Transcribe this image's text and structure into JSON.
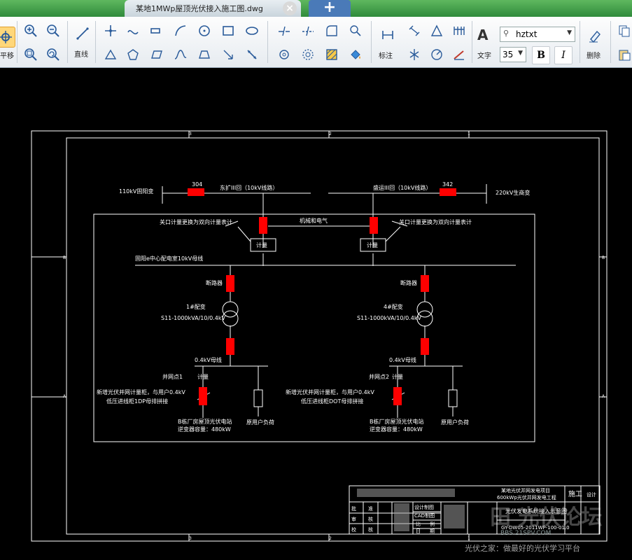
{
  "window": {
    "tab_title": "某地1MWp屋顶光伏接入施工图.dwg",
    "tab_close_icon": "close-icon",
    "tab_new_icon": "plus-icon"
  },
  "toolbar": {
    "move_label": "平移",
    "line_label": "直线",
    "dimension_label": "标注",
    "text_label": "文字",
    "delete_label": "删除",
    "font_value": "hztxt",
    "font_size_value": "35",
    "bold_label": "B",
    "italic_label": "I"
  },
  "drawing": {
    "grid_top": [
      "3",
      "2",
      "1"
    ],
    "grid_bottom": [
      "3",
      "2",
      "1"
    ],
    "grid_side": [
      "B",
      "A"
    ],
    "left_source": "110kV固阳变",
    "left_switch": "304",
    "left_line": "东扩III回（10kV线路）",
    "right_line": "盛运III回（10kV线路）",
    "right_switch": "342",
    "right_source": "220kV生商变",
    "meter_note_left": "关口计量更换为双向计量表计",
    "meter_note_right": "关口计量更换为双向计量表计",
    "tie_label": "机械和电气",
    "meter_left": "计量",
    "meter_right": "计量",
    "bus_10kv": "固阳e中心配电室10kV母线",
    "breaker_left": "断路器",
    "breaker_right": "断路器",
    "transformer_left_name": "1#配变",
    "transformer_left_model": "S11-1000kVA/10/0.4kV",
    "transformer_right_name": "4#配变",
    "transformer_right_model": "S11-1000kVA/10/0.4kV",
    "bus_04kv_left": "0.4kV母线",
    "bus_04kv_right": "0.4kV母线",
    "grid_point_left": "并网点1",
    "grid_point_right": "并网点2",
    "meter_small_left": "计量",
    "meter_small_right": "计量",
    "new_cabinet_left_1": "新增光伏并网计量柜，与用户0.4kV",
    "new_cabinet_left_2": "低压进线柜1DP母排拼接",
    "new_cabinet_right_1": "新增光伏并网计量柜，与用户0.4kV",
    "new_cabinet_right_2": "低压进线柜DOT母排拼接",
    "pv_left_1": "B栋厂房屋顶光伏电站",
    "pv_left_2": "逆变器容量：480kW",
    "pv_right_1": "B栋厂房屋顶光伏电站",
    "pv_right_2": "逆变器容量：480kW",
    "load_left": "原用户负荷",
    "load_right": "原用户负荷"
  },
  "title_block": {
    "project": "某地光伏并网发电项目",
    "project_sub": "600kWp光伏并网发电工程",
    "stage": "施工",
    "stage_sub": "设计",
    "row1_a": "批",
    "row1_b": "准",
    "row2_a": "审",
    "row2_b": "核",
    "row3_a": "校",
    "row3_b": "核",
    "col_c1": "设计制图",
    "col_c2": "CAD制图",
    "col_c3": "比",
    "col_c3b": "例",
    "col_c4": "日",
    "col_c4b": "期",
    "drawing_title": "光伏发电系统接入示意图",
    "drawing_no": "GY-DW05-2011WP-100-01.0"
  },
  "watermark": {
    "site": "BBS.21SPV.COM",
    "slogan": "光伏之家：做最好的光伏学习平台"
  },
  "colors": {
    "title_green": "#2f8a3b",
    "switch_red": "#ff0000",
    "line_white": "#ffffff"
  }
}
